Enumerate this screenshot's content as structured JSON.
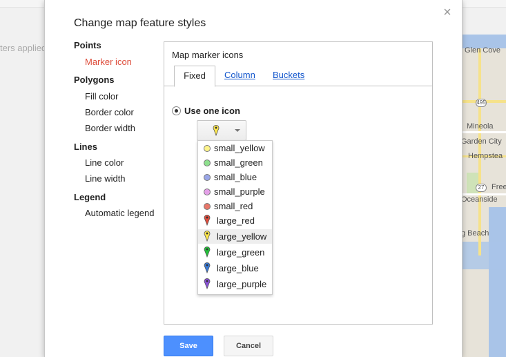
{
  "background": {
    "filter_text": "ters applied",
    "map_labels": {
      "glen_cove": "Glen Cove",
      "mineola": "Mineola",
      "garden_city": "Garden City",
      "hempstead": "Hempstea",
      "oceanside": "Oceanside",
      "beach": "g Beach",
      "free": "Free",
      "route_495": "495",
      "route_27": "27"
    }
  },
  "dialog": {
    "title": "Change map feature styles",
    "close_glyph": "×",
    "sidebar": {
      "points": {
        "label": "Points",
        "items": [
          "Marker icon"
        ]
      },
      "polygons": {
        "label": "Polygons",
        "items": [
          "Fill color",
          "Border color",
          "Border width"
        ]
      },
      "lines": {
        "label": "Lines",
        "items": [
          "Line color",
          "Line width"
        ]
      },
      "legend": {
        "label": "Legend",
        "items": [
          "Automatic legend"
        ]
      }
    },
    "panel": {
      "title": "Map marker icons",
      "tabs": [
        "Fixed",
        "Column",
        "Buckets"
      ],
      "radio_label": "Use one icon",
      "selected_icon": "large_yellow",
      "icons": [
        {
          "label": "small_yellow",
          "kind": "small",
          "color": "#fdf48a"
        },
        {
          "label": "small_green",
          "kind": "small",
          "color": "#8ee08e"
        },
        {
          "label": "small_blue",
          "kind": "small",
          "color": "#9aa6e8"
        },
        {
          "label": "small_purple",
          "kind": "small",
          "color": "#e4a0e8"
        },
        {
          "label": "small_red",
          "kind": "small",
          "color": "#e8776a"
        },
        {
          "label": "large_red",
          "kind": "large",
          "color": "#e24c3c"
        },
        {
          "label": "large_yellow",
          "kind": "large",
          "color": "#fde74c"
        },
        {
          "label": "large_green",
          "kind": "large",
          "color": "#22c43a"
        },
        {
          "label": "large_blue",
          "kind": "large",
          "color": "#3a7bd8"
        },
        {
          "label": "large_purple",
          "kind": "large",
          "color": "#8a52d8"
        }
      ]
    },
    "buttons": {
      "save": "Save",
      "cancel": "Cancel"
    },
    "colors": {
      "accent": "#dd4b39",
      "link": "#1155cc",
      "primary": "#4d90fe"
    }
  }
}
